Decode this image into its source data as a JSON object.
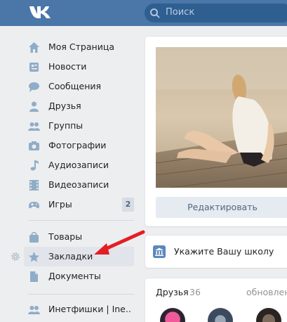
{
  "header": {
    "logo": "vk-logo",
    "search_placeholder": "Поиск"
  },
  "sidebar": {
    "items": [
      {
        "label": "Моя Страница",
        "icon": "home-icon"
      },
      {
        "label": "Новости",
        "icon": "news-icon"
      },
      {
        "label": "Сообщения",
        "icon": "messages-icon"
      },
      {
        "label": "Друзья",
        "icon": "friend-icon"
      },
      {
        "label": "Группы",
        "icon": "groups-icon"
      },
      {
        "label": "Фотографии",
        "icon": "camera-icon"
      },
      {
        "label": "Аудиозаписи",
        "icon": "music-note-icon"
      },
      {
        "label": "Видеозаписи",
        "icon": "film-icon"
      },
      {
        "label": "Игры",
        "icon": "gamepad-icon",
        "counter": "2"
      },
      {
        "label": "Товары",
        "icon": "bag-icon"
      },
      {
        "label": "Закладки",
        "icon": "star-icon",
        "active": true
      },
      {
        "label": "Документы",
        "icon": "document-icon"
      },
      {
        "label": "Инетфишки | Ine..",
        "icon": "group-icon"
      }
    ]
  },
  "profile": {
    "edit_button": "Редактировать"
  },
  "school_prompt": {
    "text": "Укажите Вашу школу",
    "icon": "school-icon"
  },
  "friends": {
    "title": "Друзья",
    "count": "36",
    "updated": "обновлен"
  },
  "colors": {
    "header": "#4a76a8",
    "background": "#edeef0",
    "annotation_arrow": "#e31e24",
    "icon": "#8fadc8"
  }
}
